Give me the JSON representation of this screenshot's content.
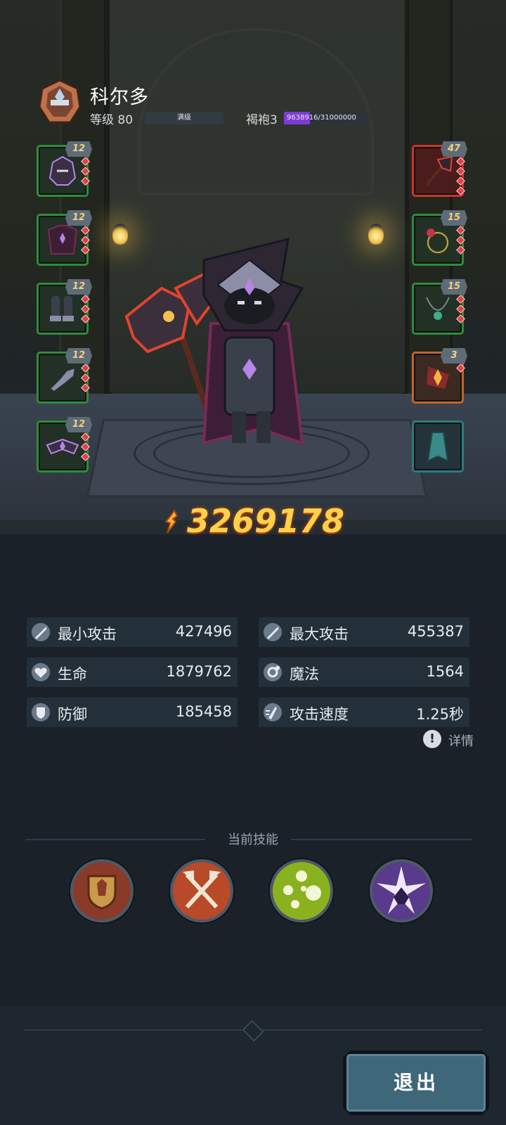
{
  "hero": {
    "name": "科尔多",
    "level_label": "等级 80",
    "level_bar_text": "满级",
    "robe_label": "褐袍3",
    "robe_progress_text": "9638916/31000000",
    "robe_progress": 0.311
  },
  "equipment_left": [
    {
      "level": "12",
      "icon": "helmet-icon"
    },
    {
      "level": "12",
      "icon": "armor-icon"
    },
    {
      "level": "12",
      "icon": "boots-icon"
    },
    {
      "level": "12",
      "icon": "gloves-icon"
    },
    {
      "level": "12",
      "icon": "belt-icon"
    }
  ],
  "equipment_right": [
    {
      "level": "47",
      "icon": "weapon-icon"
    },
    {
      "level": "15",
      "icon": "ring-icon"
    },
    {
      "level": "15",
      "icon": "necklace-icon"
    },
    {
      "level": "3",
      "icon": "relic-icon"
    },
    {
      "level": "",
      "icon": "cloak-icon"
    }
  ],
  "combat_power": "3269178",
  "stats": [
    {
      "label": "最小攻击",
      "value": "427496",
      "icon": "sword-icon"
    },
    {
      "label": "最大攻击",
      "value": "455387",
      "icon": "sword-icon"
    },
    {
      "label": "生命",
      "value": "1879762",
      "icon": "heart-icon"
    },
    {
      "label": "魔法",
      "value": "1564",
      "icon": "magic-icon"
    },
    {
      "label": "防御",
      "value": "185458",
      "icon": "shield-icon"
    },
    {
      "label": "攻击速度",
      "value": "1.25秒",
      "icon": "speed-icon"
    }
  ],
  "details_label": "详情",
  "skills_title": "当前技能",
  "skills": [
    {
      "icon": "guard-shield-icon",
      "color": "#8a3a28"
    },
    {
      "icon": "crossed-axes-icon",
      "color": "#b84a2a"
    },
    {
      "icon": "poison-orbs-icon",
      "color": "#8ab21e"
    },
    {
      "icon": "shadow-burst-icon",
      "color": "#5a3a8a"
    }
  ],
  "exit_label": "退出"
}
